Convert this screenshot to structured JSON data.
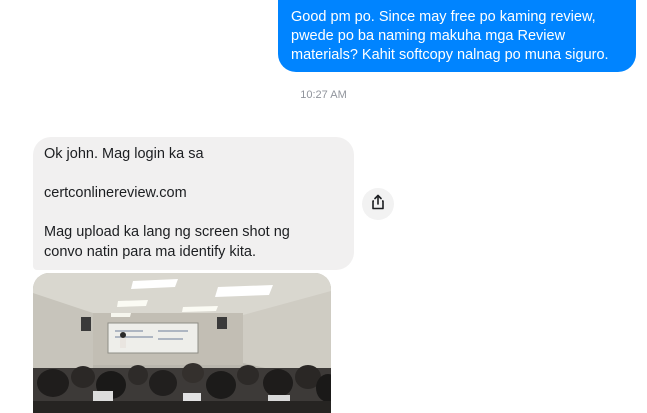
{
  "messages": {
    "outgoing": {
      "lines": [
        "Good pm po. Since may free po kaming review,",
        "pwede po ba naming makuha mga Review",
        "materials? Kahit softcopy nalnag po muna siguro."
      ],
      "color": "#0084ff"
    },
    "timestamp": "10:27 AM",
    "incoming": {
      "line1": "Ok john. Mag login ka sa",
      "line2": "certconlinereview.com",
      "line3": "Mag upload ka lang ng screen shot ng",
      "line4": "convo natin para ma identify kita.",
      "color": "#f1f0f0"
    },
    "share_icon": "share-icon",
    "photo": {
      "description_icon": "classroom-photo"
    }
  }
}
